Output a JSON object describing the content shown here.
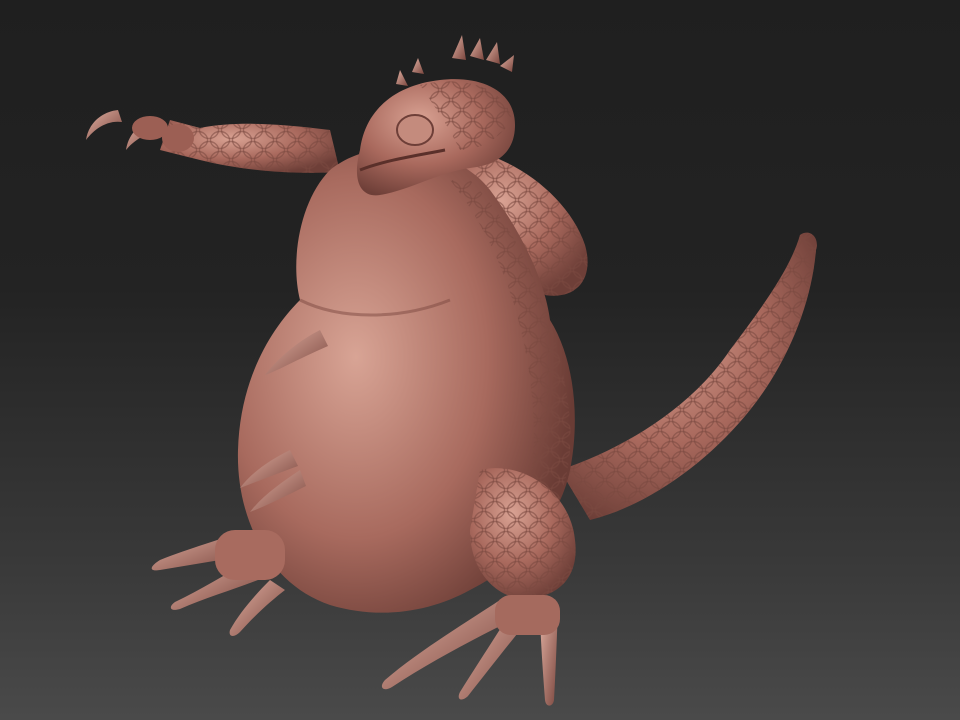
{
  "scene": {
    "subject": "sculpted-creature",
    "colors": {
      "background_top": "#1f1f1f",
      "background_bottom": "#4a4a4a",
      "clay_base": "#b3766a",
      "clay_shadow": "#6e3f38",
      "clay_highlight": "#d9a293"
    }
  }
}
